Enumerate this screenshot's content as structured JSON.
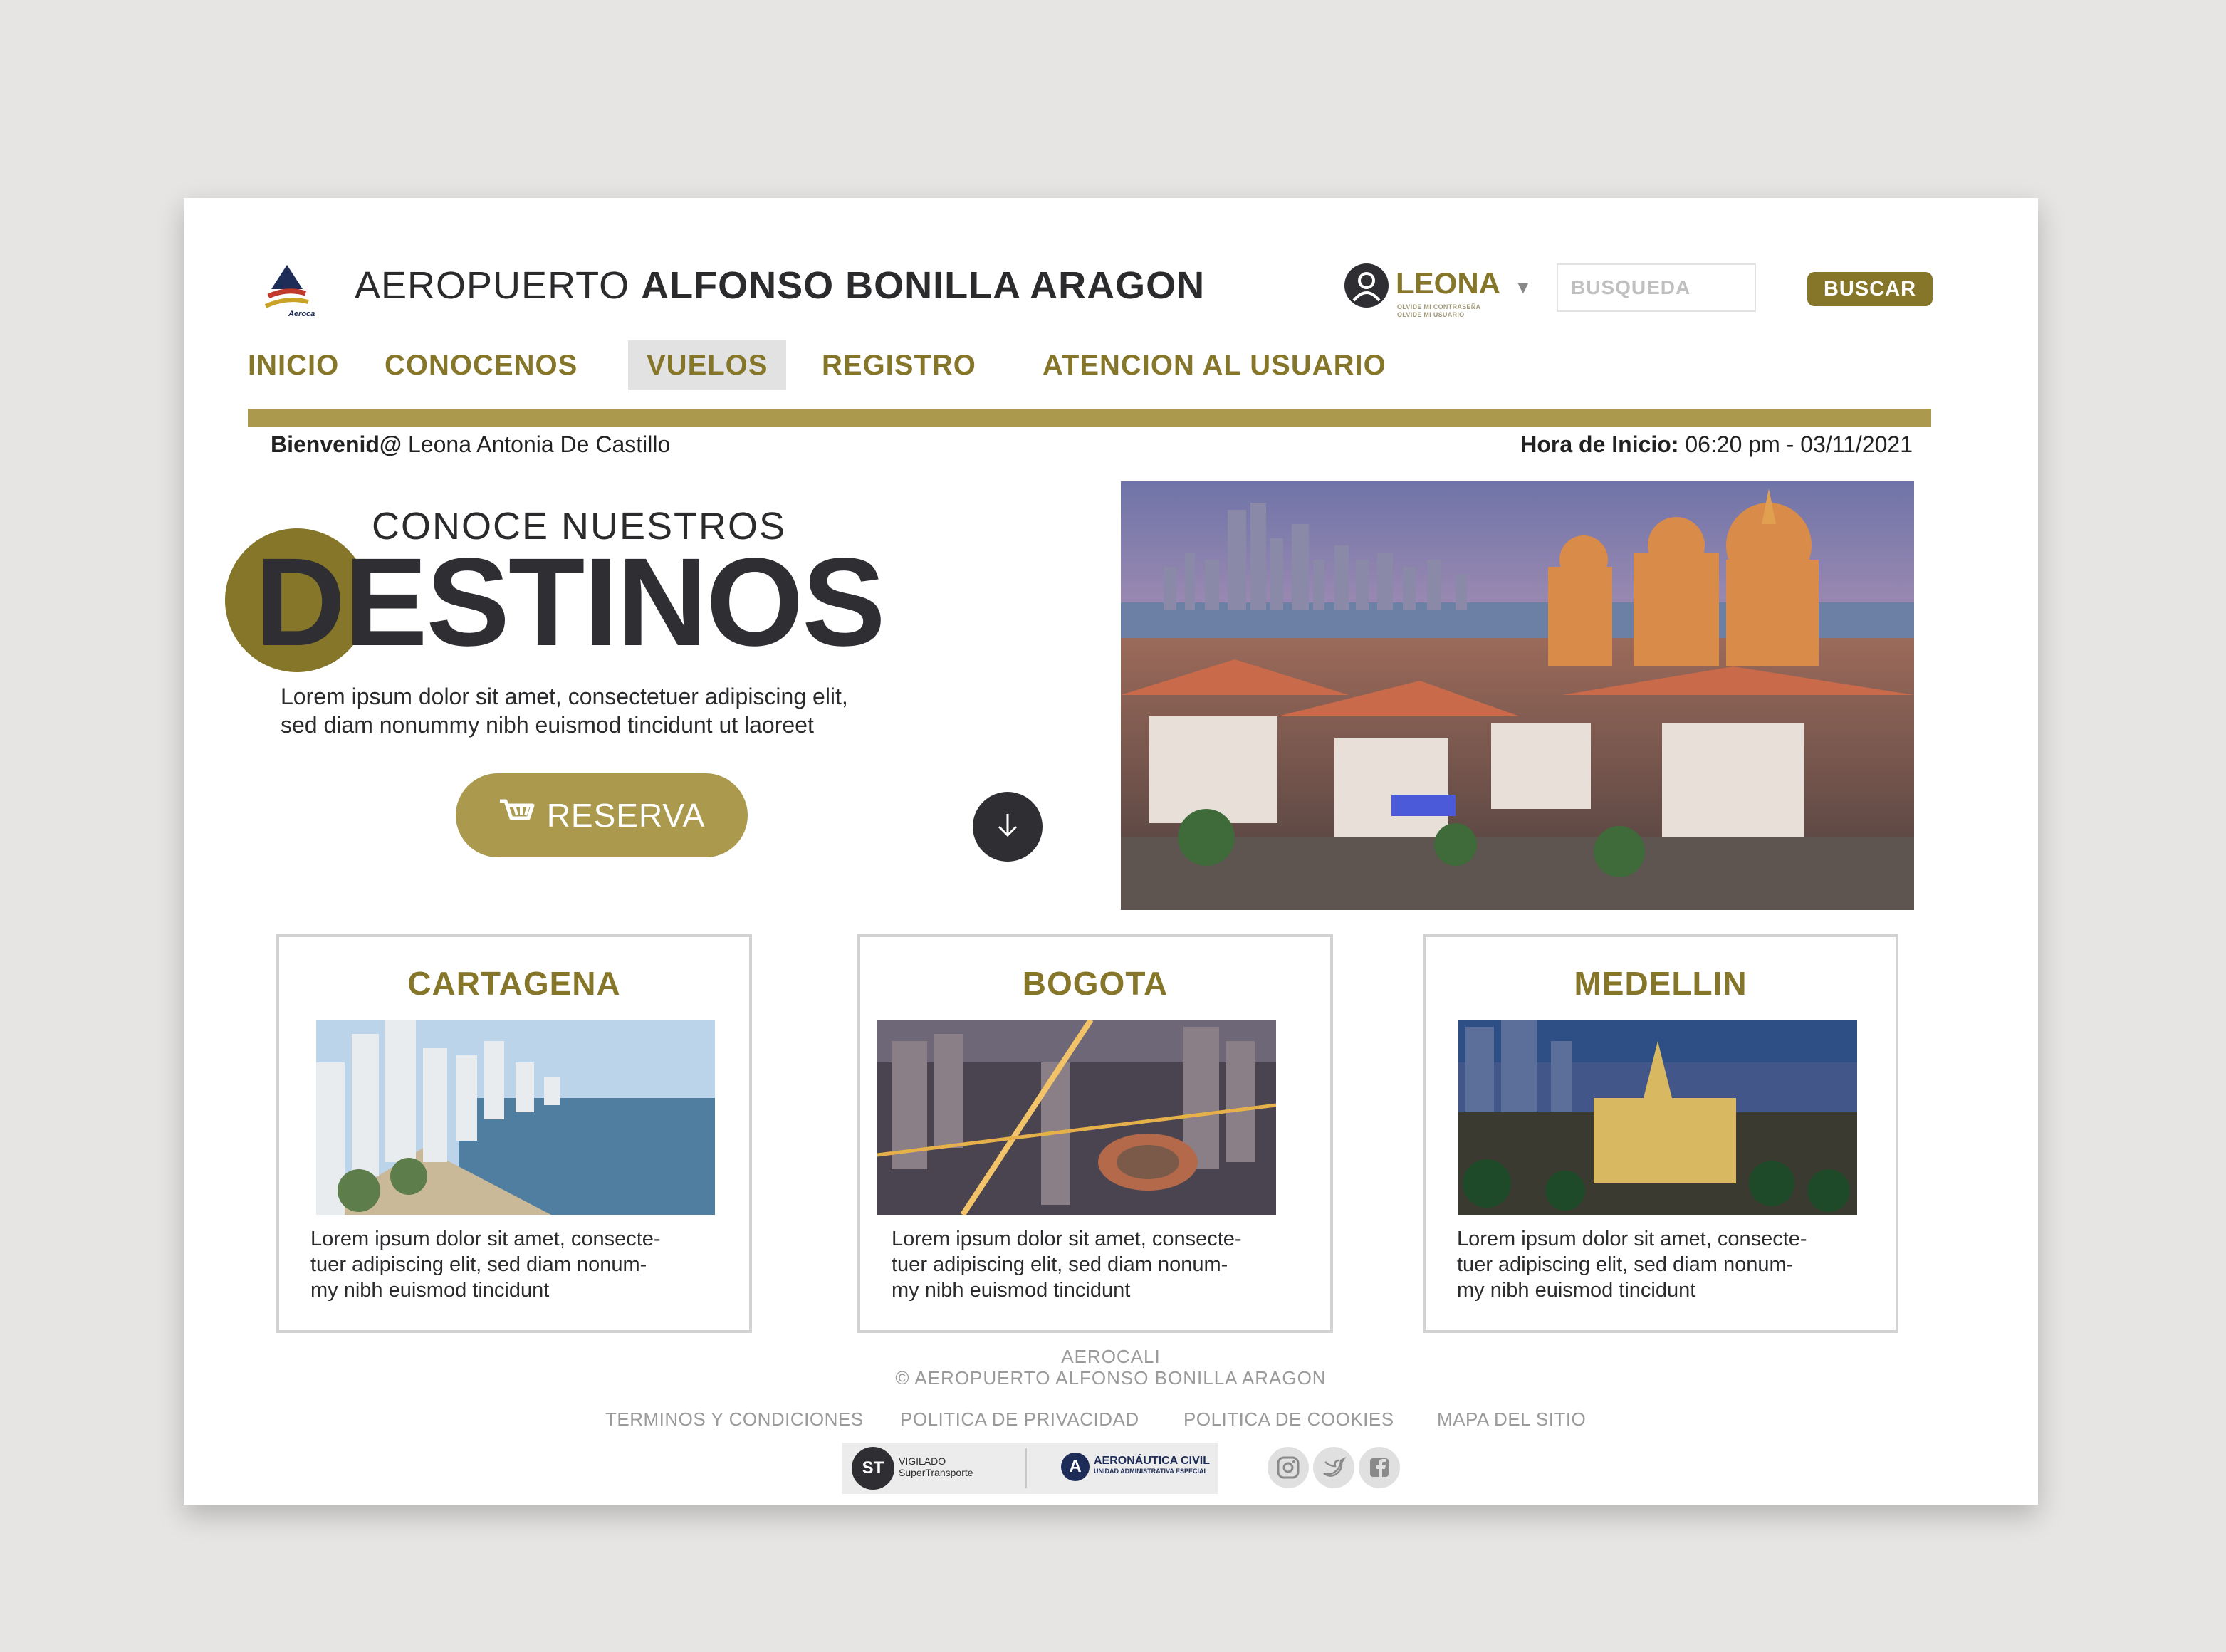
{
  "header": {
    "logo_text": "Aerocali",
    "title_light": "AEROPUERTO",
    "title_bold": "ALFONSO BONILLA ARAGON"
  },
  "user": {
    "name": "LEONA",
    "links": [
      "OLVIDE MI CONTRASEÑA",
      "OLVIDE MI USUARIO"
    ],
    "caret": "▼"
  },
  "search": {
    "placeholder": "BUSQUEDA",
    "button_label": "BUSCAR"
  },
  "nav": {
    "items": [
      "INICIO",
      "CONOCENOS",
      "VUELOS",
      "REGISTRO",
      "ATENCION AL USUARIO"
    ],
    "active": "VUELOS"
  },
  "status": {
    "welcome_label": "Bienvenid@",
    "welcome_name": "Leona Antonia De Castillo",
    "start_label": "Hora de Inicio:",
    "start_value": "06:20 pm - 03/11/2021"
  },
  "hero": {
    "subtitle": "CONOCE NUESTROS",
    "title": "DESTINOS",
    "text_line1": "Lorem ipsum dolor sit amet, consectetuer adipiscing elit,",
    "text_line2": "sed diam nonummy nibh euismod tincidunt ut laoreet",
    "button_label": "RESERVA",
    "cart_icon": "cart-icon",
    "scroll_icon": "arrow-down-icon"
  },
  "destinations": [
    {
      "name": "CARTAGENA",
      "line1": "Lorem ipsum dolor sit amet, consecte-",
      "line2": "tuer adipiscing elit, sed diam nonum-",
      "line3": "my nibh euismod tincidunt"
    },
    {
      "name": "BOGOTA",
      "line1": "Lorem ipsum dolor sit amet, consecte-",
      "line2": "tuer adipiscing elit, sed diam nonum-",
      "line3": "my nibh euismod tincidunt"
    },
    {
      "name": "MEDELLIN",
      "line1": "Lorem ipsum dolor sit amet, consecte-",
      "line2": "tuer adipiscing elit, sed diam nonum-",
      "line3": "my nibh euismod tincidunt"
    }
  ],
  "footer": {
    "brand": "AEROCALI",
    "copyright": "© AEROPUERTO ALFONSO BONILLA ARAGON",
    "links": [
      "TERMINOS Y CONDICIONES",
      "POLITICA DE PRIVACIDAD",
      "POLITICA DE COOKIES",
      "MAPA DEL SITIO"
    ],
    "badge1_logo": "ST",
    "badge1_line1": "VIGILADO",
    "badge1_line2": "SuperTransporte",
    "badge2_logo": "A",
    "badge2_line1": "AERONÁUTICA CIVIL",
    "badge2_line2": "UNIDAD ADMINISTRATIVA ESPECIAL",
    "social_icons": [
      "instagram-icon",
      "twitter-icon",
      "facebook-icon"
    ]
  },
  "colors": {
    "brand_gold": "#85762a",
    "light_gold": "#ab9a4d",
    "dark": "#2f2f33",
    "background": "#e6e5e3"
  }
}
